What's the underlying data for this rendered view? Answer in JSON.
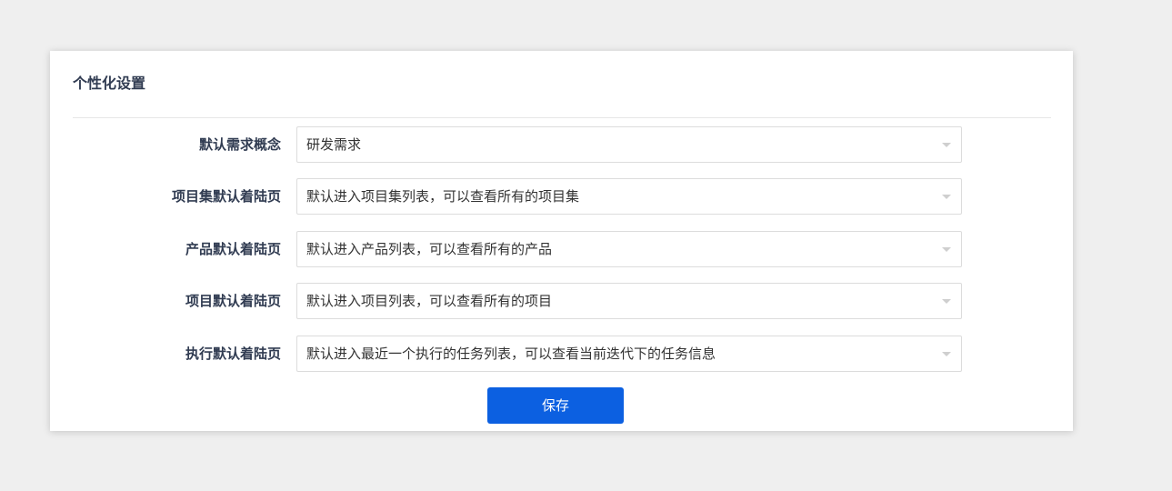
{
  "panel": {
    "title": "个性化设置"
  },
  "form": {
    "rows": [
      {
        "label": "默认需求概念",
        "value": "研发需求"
      },
      {
        "label": "项目集默认着陆页",
        "value": "默认进入项目集列表，可以查看所有的项目集"
      },
      {
        "label": "产品默认着陆页",
        "value": "默认进入产品列表，可以查看所有的产品"
      },
      {
        "label": "项目默认着陆页",
        "value": "默认进入项目列表，可以查看所有的项目"
      },
      {
        "label": "执行默认着陆页",
        "value": "默认进入最近一个执行的任务列表，可以查看当前迭代下的任务信息"
      }
    ]
  },
  "actions": {
    "save_label": "保存"
  },
  "colors": {
    "background": "#efefef",
    "panel": "#ffffff",
    "primary": "#0c60e1",
    "label": "#313c52",
    "border": "#dcdcdc"
  }
}
